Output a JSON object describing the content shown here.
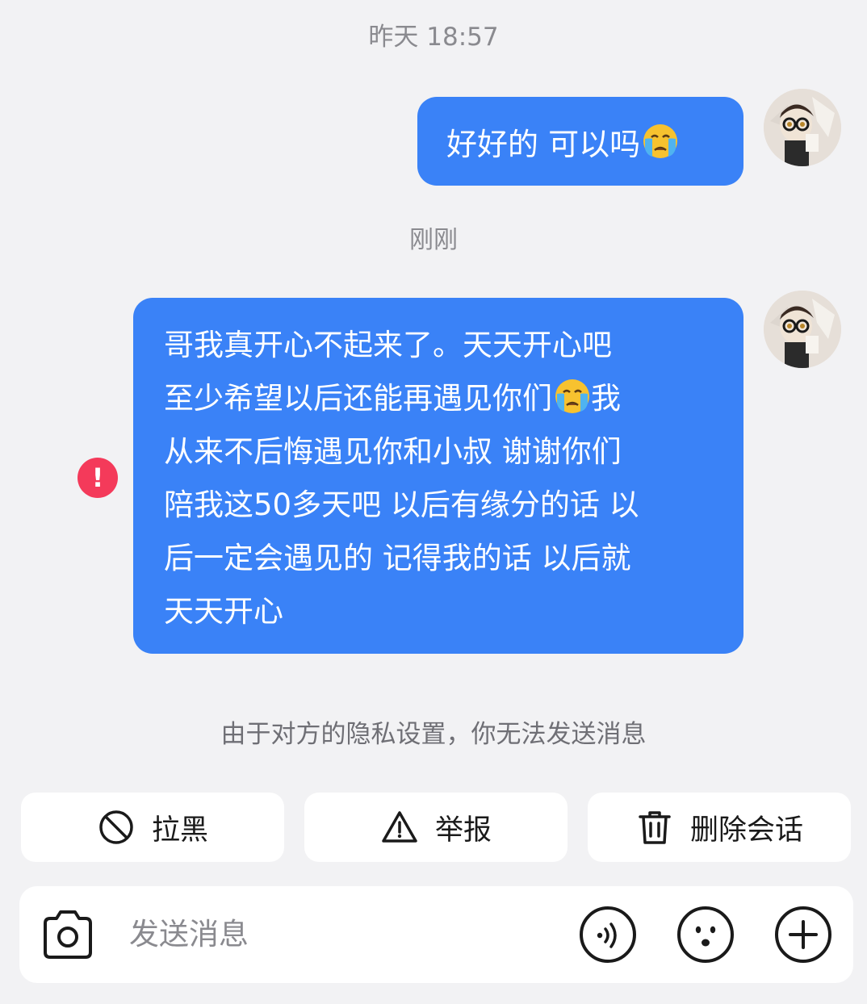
{
  "timestamps": {
    "first": "昨天 18:57",
    "second": "刚刚"
  },
  "messages": {
    "first": {
      "text": "好好的 可以吗",
      "emoji": "loudly-crying-face"
    },
    "second": {
      "lines": [
        "哥我真开心不起来了。天天开心吧",
        "至少希望以后还能再遇见你们",
        "从来不后悔遇见你和小叔 谢谢你们",
        "陪我这50多天吧 以后有缘分的话 以",
        "后一定会遇见的 记得我的话 以后就",
        "天天开心"
      ],
      "line2_suffix": "我",
      "emoji": "loudly-crying-face",
      "error_mark": "!"
    }
  },
  "privacy_note": "由于对方的隐私设置，你无法发送消息",
  "actions": {
    "block": "拉黑",
    "report": "举报",
    "delete": "删除会话"
  },
  "input_bar": {
    "placeholder": "发送消息",
    "icons": [
      "camera-icon",
      "voice-icon",
      "emoji-face-icon",
      "plus-icon"
    ]
  },
  "colors": {
    "bubble": "#3a82f7",
    "error": "#f43a5a",
    "background": "#f2f2f4"
  }
}
